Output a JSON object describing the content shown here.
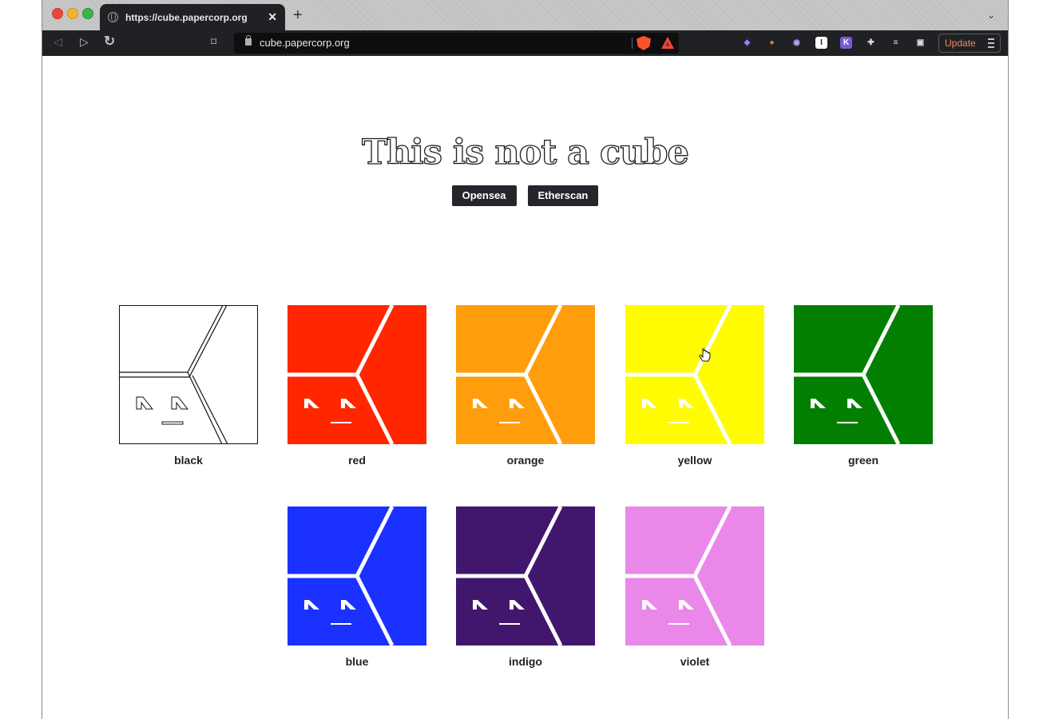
{
  "browser": {
    "tab_title": "https://cube.papercorp.org",
    "tab_close": "✕",
    "new_tab": "+",
    "url": "cube.papercorp.org",
    "update_label": "Update",
    "nav": {
      "back": "◁",
      "forward": "▷",
      "reload": "↻",
      "bookmark": "⌑"
    },
    "extensions": [
      {
        "name": "gem-icon",
        "glyph": "◆",
        "color": "#9b7bff",
        "bg": "transparent"
      },
      {
        "name": "fox-icon",
        "glyph": "●",
        "color": "#e8821e",
        "bg": "transparent"
      },
      {
        "name": "ghost-icon",
        "glyph": "◉",
        "color": "#b9a7ff",
        "bg": "transparent"
      },
      {
        "name": "i-extension-icon",
        "glyph": "I",
        "color": "#202124",
        "bg": "#ffffff"
      },
      {
        "name": "k-extension-icon",
        "glyph": "K",
        "color": "#ffffff",
        "bg": "#7a5bd6"
      },
      {
        "name": "puzzle-icon",
        "glyph": "✚",
        "color": "#e0e0e0",
        "bg": "transparent"
      },
      {
        "name": "playlist-icon",
        "glyph": "≡",
        "color": "#e0e0e0",
        "bg": "transparent"
      },
      {
        "name": "wallet-icon",
        "glyph": "▣",
        "color": "#e0e0e0",
        "bg": "transparent"
      }
    ]
  },
  "page": {
    "title": "This is not a cube",
    "buttons": {
      "opensea": "Opensea",
      "etherscan": "Etherscan"
    },
    "cubes": [
      {
        "label": "black",
        "color": "#ffffff",
        "outline": true
      },
      {
        "label": "red",
        "color": "#ff2600"
      },
      {
        "label": "orange",
        "color": "#ff9d0d"
      },
      {
        "label": "yellow",
        "color": "#fffb00"
      },
      {
        "label": "green",
        "color": "#027f00"
      },
      {
        "label": "blue",
        "color": "#1b31ff"
      },
      {
        "label": "indigo",
        "color": "#41176e"
      },
      {
        "label": "violet",
        "color": "#ea88e9"
      }
    ]
  }
}
